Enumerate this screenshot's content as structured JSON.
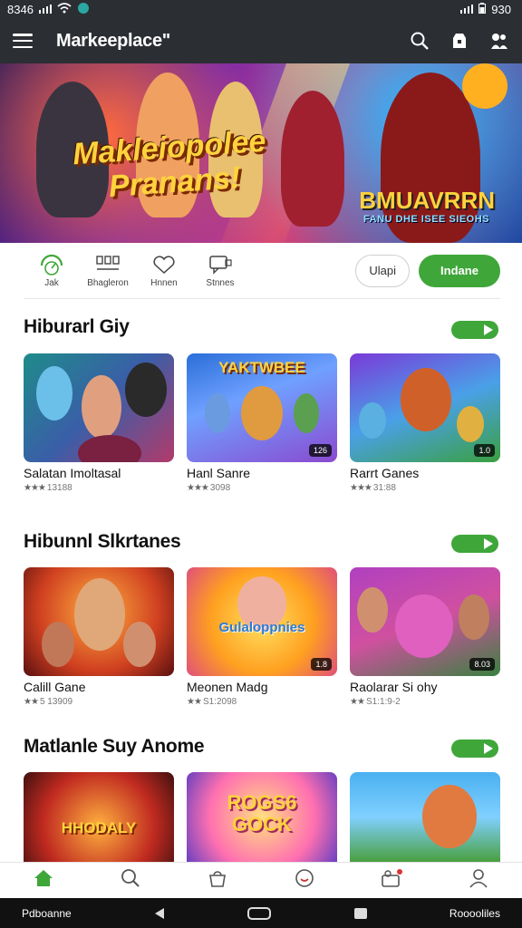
{
  "status_bar": {
    "time": "8346",
    "right_time": "930"
  },
  "app_bar": {
    "title": "Markeeplace\"",
    "icons": [
      "menu-icon",
      "search-icon",
      "store-icon",
      "profile-icon"
    ]
  },
  "hero": {
    "title_line1": "Makleiopolee",
    "title_line2": "Pranans!",
    "brand": "BMUAVRRN",
    "subtitle": "FANU DHE ISEE SIEOHS"
  },
  "quick_actions": [
    {
      "label": "Jak",
      "icon": "speedometer-icon"
    },
    {
      "label": "Bhagleron",
      "icon": "list-icon"
    },
    {
      "label": "Hnnen",
      "icon": "heart-icon"
    },
    {
      "label": "Stnnes",
      "icon": "chat-icon"
    }
  ],
  "quick_buttons": {
    "outline": "Ulapi",
    "primary": "Indane"
  },
  "sections": [
    {
      "title": "Hiburarl Giy",
      "items": [
        {
          "name": "Salatan Imoltasal",
          "rating": "13188",
          "badge": ""
        },
        {
          "name": "Hanl Sanre",
          "rating": "3098",
          "badge": "126"
        },
        {
          "name": "Rarrt Ganes",
          "rating": "31:88",
          "badge": "1.0"
        }
      ]
    },
    {
      "title": "Hibunnl Slkrtanes",
      "items": [
        {
          "name": "Calill Gane",
          "rating": "5 13909",
          "badge": ""
        },
        {
          "name": "Meonen Madg",
          "rating": "S1:2098",
          "badge": "1.8"
        },
        {
          "name": "Raolarar Si ohy",
          "rating": "S1:1:9-2",
          "badge": "8.03"
        }
      ]
    },
    {
      "title": "Matlanle Suy Anome",
      "items": [
        {
          "name": "",
          "rating": "",
          "badge": "",
          "art": "HHODALY"
        },
        {
          "name": "",
          "rating": "",
          "badge": "",
          "art": "ROGS6 GOCK"
        },
        {
          "name": "",
          "rating": "",
          "badge": "",
          "art": ""
        }
      ]
    }
  ],
  "bottom_nav": [
    "home-icon",
    "search-icon",
    "bag-icon",
    "clock-icon",
    "users-icon",
    "account-icon"
  ],
  "system_nav": {
    "left": "Pdboanne",
    "right": "Rooooliles"
  },
  "colors": {
    "accent": "#3fa63a",
    "header": "#2b2e33"
  }
}
